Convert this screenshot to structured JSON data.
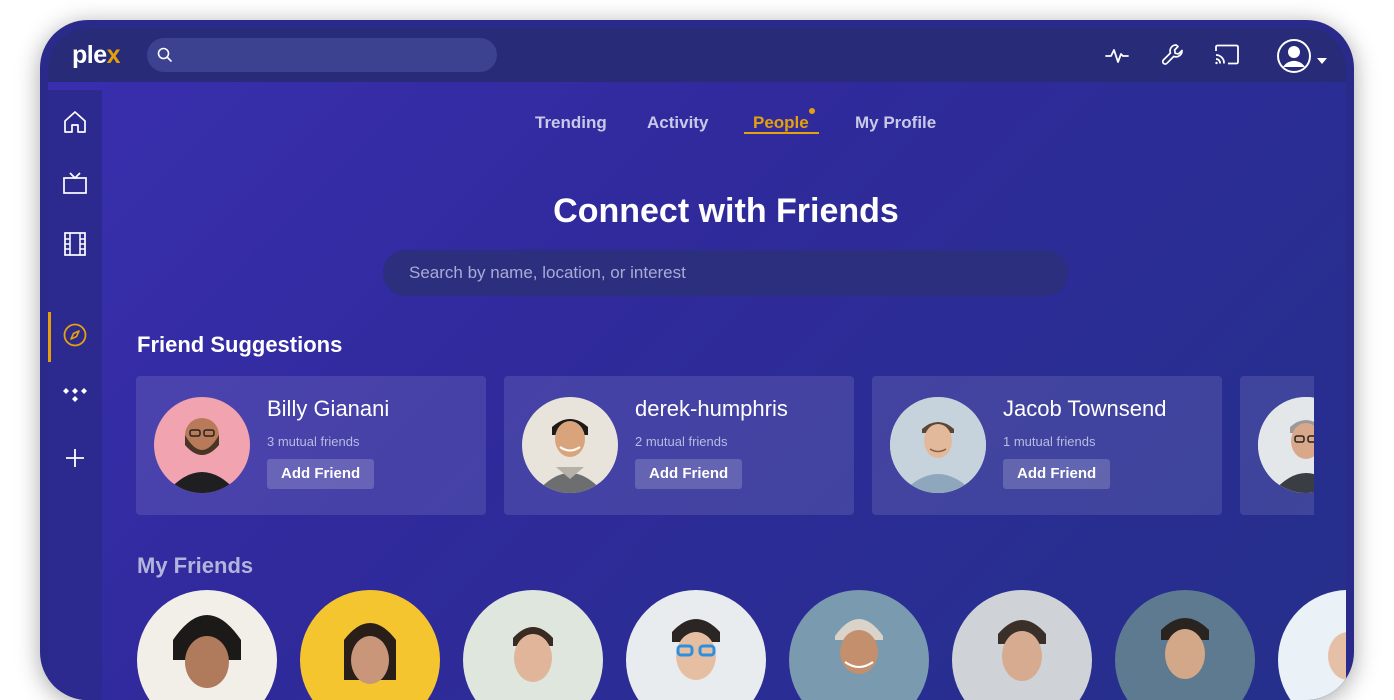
{
  "app": {
    "logo_text": "ple",
    "logo_accent": "x",
    "accent_color": "#e5a00d"
  },
  "topbar": {
    "search_placeholder": "",
    "icons": [
      "search-icon",
      "activity-icon",
      "wrench-icon",
      "cast-icon",
      "user-avatar-icon",
      "caret-down-icon"
    ]
  },
  "sidebar": {
    "items": [
      {
        "icon": "home-icon"
      },
      {
        "icon": "tv-icon"
      },
      {
        "icon": "film-icon"
      },
      {
        "icon": "compass-icon",
        "active": true
      },
      {
        "icon": "tidal-icon"
      },
      {
        "icon": "plus-icon"
      }
    ]
  },
  "tabs": [
    {
      "label": "Trending"
    },
    {
      "label": "Activity"
    },
    {
      "label": "People",
      "active": true,
      "has_dot": true
    },
    {
      "label": "My Profile"
    }
  ],
  "page": {
    "title": "Connect with Friends",
    "search_placeholder": "Search by name, location, or interest"
  },
  "suggestions": {
    "title": "Friend Suggestions",
    "cards": [
      {
        "name": "Billy Gianani",
        "mutual": "3 mutual friends",
        "button": "Add Friend",
        "photo_bg": "#f2a3b0"
      },
      {
        "name": "derek-humphris",
        "mutual": "2 mutual friends",
        "button": "Add Friend",
        "photo_bg": "#e8e4dc"
      },
      {
        "name": "Jacob Townsend",
        "mutual": "1 mutual friends",
        "button": "Add Friend",
        "photo_bg": "#b9c9d6"
      }
    ]
  },
  "friends": {
    "title": "My Friends",
    "photo_colors": [
      "#f2efe9",
      "#f5c530",
      "#dfe6de",
      "#e9ecee",
      "#7a9ab0",
      "#cfd2d6",
      "#5d7a91",
      "#eaf2f8"
    ]
  }
}
